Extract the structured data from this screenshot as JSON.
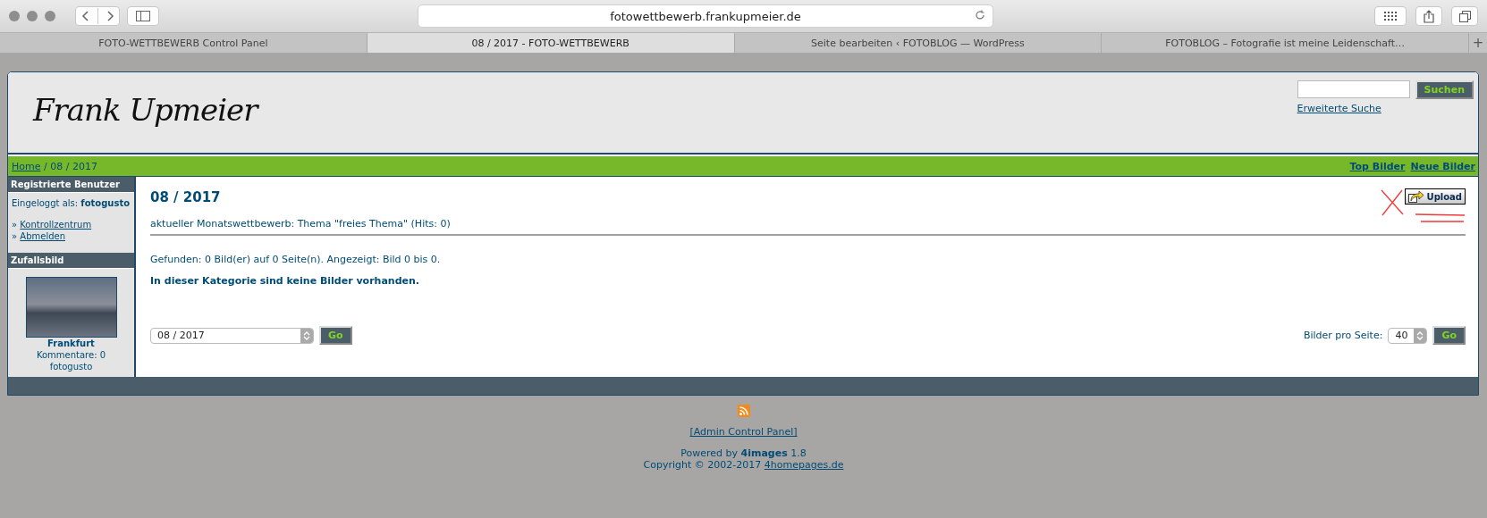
{
  "browser": {
    "address": "fotowettbewerb.frankupmeier.de",
    "tabs": [
      {
        "label": "FOTO-WETTBEWERB Control Panel",
        "selected": false
      },
      {
        "label": "08 / 2017 - FOTO-WETTBEWERB",
        "selected": true
      },
      {
        "label": "Seite bearbeiten ‹ FOTOBLOG — WordPress",
        "selected": false
      },
      {
        "label": "FOTOBLOG – Fotografie ist meine Leidenschaft…",
        "selected": false
      }
    ],
    "new_tab": "+"
  },
  "header": {
    "logo": "Frank Upmeier",
    "search": {
      "button": "Suchen",
      "advanced": "Erweiterte Suche"
    }
  },
  "nav": {
    "breadcrumb": {
      "home": "Home",
      "current": "/ 08 / 2017"
    },
    "links": [
      "Top Bilder",
      "Neue Bilder"
    ]
  },
  "sidebar": {
    "sections": [
      {
        "kind": "user",
        "title": "Registrierte Benutzer",
        "login": "Eingeloggt als: **fotogusto**",
        "links": [
          {
            "bullet": "»",
            "label": "Kontrollzentrum"
          },
          {
            "bullet": "»",
            "label": "Abmelden"
          }
        ]
      },
      {
        "kind": "image",
        "title": "Zufallsbild",
        "name": "Frankfurt",
        "comments": "Kommentare: 0",
        "user": "fotogusto"
      }
    ]
  },
  "main": {
    "title": "08 / 2017",
    "subtitle": "aktueller Monatswettbewerb: Thema \"freies Thema\" (Hits: 0)",
    "upload": "Upload",
    "found": "Gefunden: 0 Bild(er) auf 0 Seite(n). Angezeigt: Bild 0 bis 0.",
    "empty": "In dieser Kategorie sind keine Bilder vorhanden.",
    "category_select": {
      "value": "08 / 2017",
      "button": "Go"
    },
    "per_page": {
      "label": "Bilder pro Seite:",
      "value": "40",
      "button": "Go"
    }
  },
  "footer": {
    "admin": "[Admin Control Panel]",
    "powered": "Powered by **4images** 1.8",
    "copyright": "Copyright © 2002-2017",
    "copyright_link": "4homepages.de"
  }
}
